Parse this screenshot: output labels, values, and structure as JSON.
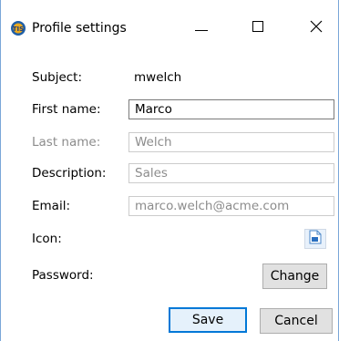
{
  "window": {
    "title": "Profile settings",
    "app_icon": "app-logo-icon"
  },
  "form": {
    "subject_label": "Subject:",
    "subject_value": "mwelch",
    "first_name_label": "First name:",
    "first_name_value": "Marco",
    "last_name_label": "Last name:",
    "last_name_value": "Welch",
    "description_label": "Description:",
    "description_value": "Sales",
    "email_label": "Email:",
    "email_value": "marco.welch@acme.com",
    "icon_label": "Icon:",
    "password_label": "Password:",
    "change_label": "Change"
  },
  "buttons": {
    "save_label": "Save",
    "cancel_label": "Cancel"
  },
  "colors": {
    "accent": "#0078d7",
    "disabled_text": "#8c8c8c"
  }
}
